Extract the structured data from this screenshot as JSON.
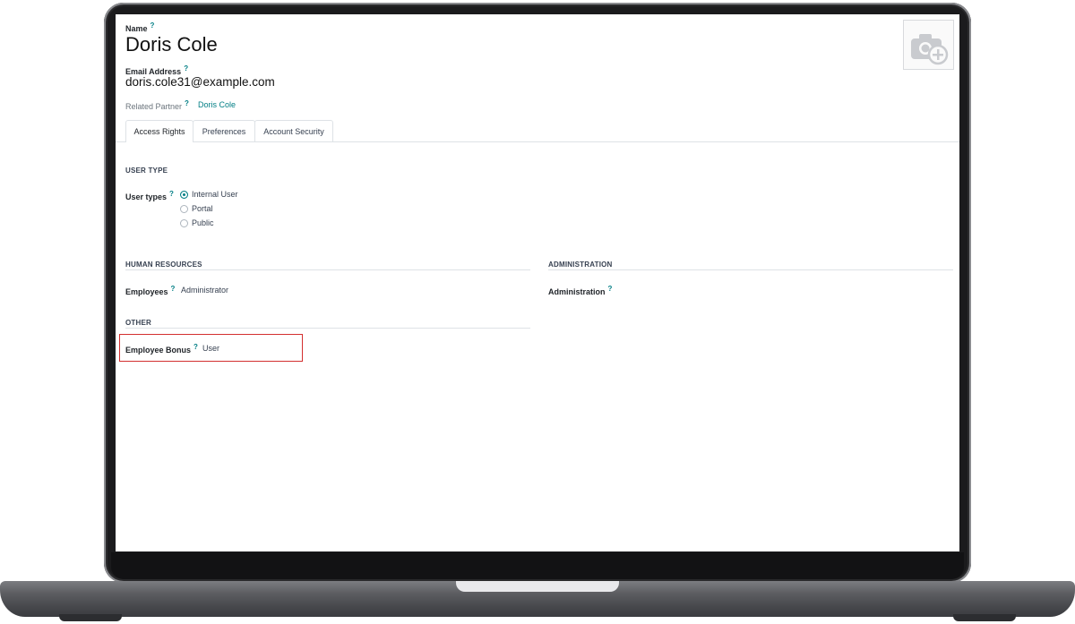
{
  "form": {
    "name_label": "Name",
    "name_value": "Doris Cole",
    "email_label": "Email Address",
    "email_value": "doris.cole31@example.com",
    "related_partner_label": "Related Partner",
    "related_partner_value": "Doris Cole",
    "help_mark": "?"
  },
  "avatar": {
    "icon": "camera-plus-icon"
  },
  "tabs": [
    {
      "label": "Access Rights",
      "active": true
    },
    {
      "label": "Preferences",
      "active": false
    },
    {
      "label": "Account Security",
      "active": false
    }
  ],
  "user_type": {
    "section_title": "USER TYPE",
    "field_label": "User types",
    "options": [
      {
        "label": "Internal User",
        "selected": true
      },
      {
        "label": "Portal",
        "selected": false
      },
      {
        "label": "Public",
        "selected": false
      }
    ]
  },
  "human_resources": {
    "section_title": "HUMAN RESOURCES",
    "employees_label": "Employees",
    "employees_value": "Administrator"
  },
  "administration": {
    "section_title": "ADMINISTRATION",
    "administration_label": "Administration"
  },
  "other": {
    "section_title": "OTHER",
    "bonus_label": "Employee Bonus",
    "bonus_value": "User"
  },
  "colors": {
    "accent": "#017e84",
    "highlight": "#d32f2f"
  }
}
